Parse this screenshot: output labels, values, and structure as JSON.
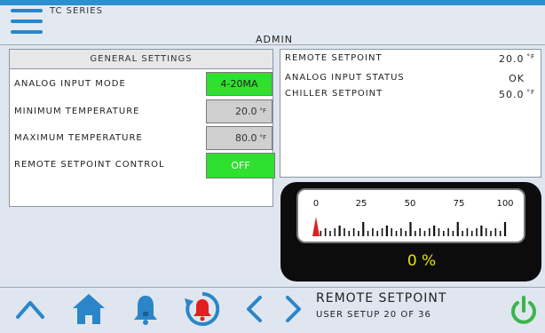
{
  "header": {
    "series": "TC SERIES",
    "user_level": "ADMIN"
  },
  "general_settings": {
    "title": "GENERAL SETTINGS",
    "rows": [
      {
        "label": "ANALOG INPUT MODE",
        "value": "4-20MA",
        "unit": "",
        "style": "green"
      },
      {
        "label": "MINIMUM TEMPERATURE",
        "value": "20.0",
        "unit": "°F",
        "style": "gray"
      },
      {
        "label": "MAXIMUM TEMPERATURE",
        "value": "80.0",
        "unit": "°F",
        "style": "gray"
      },
      {
        "label": "REMOTE SETPOINT CONTROL",
        "value": "OFF",
        "unit": "",
        "style": "green"
      }
    ]
  },
  "status_panel": {
    "rows": [
      {
        "label": "REMOTE SETPOINT",
        "value": "20.0",
        "unit": "°F"
      },
      {
        "label": "ANALOG INPUT STATUS",
        "value": "OK",
        "unit": ""
      },
      {
        "label": "CHILLER SETPOINT",
        "value": "50.0",
        "unit": "°F"
      }
    ]
  },
  "gauge": {
    "ticks": [
      "0",
      "25",
      "50",
      "75",
      "100"
    ],
    "value_percent": 0,
    "readout": "0 %"
  },
  "footer": {
    "page_title": "REMOTE SETPOINT",
    "page_sub": "USER SETUP 20 OF 36"
  },
  "colors": {
    "accent_blue": "#2a86c9",
    "active_green": "#2fe02f",
    "alarm_red": "#e02020",
    "power_green": "#3bb54a",
    "readout_yellow": "#e5e600"
  }
}
